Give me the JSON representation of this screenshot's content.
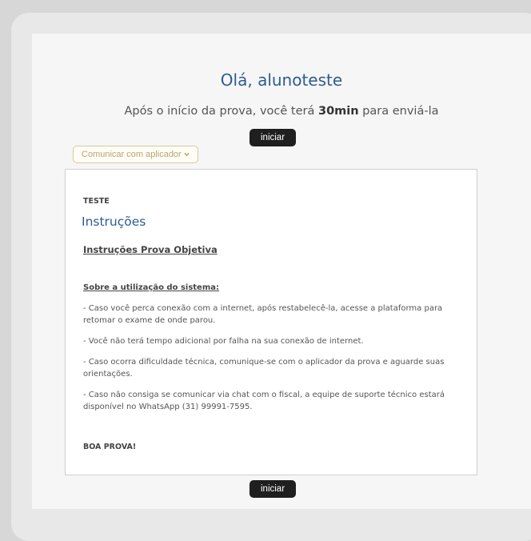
{
  "header": {
    "greeting": "Olá, alunoteste",
    "duration_before": "Após o início da prova, você terá ",
    "duration_value": "30min",
    "duration_after": " para enviá-la"
  },
  "actions": {
    "start_label": "iniciar",
    "contact_label": "Comunicar com aplicador",
    "contact_icon": "chevron-down-icon"
  },
  "content": {
    "label": "TESTE",
    "title": "Instruções",
    "subtitle": "Instruções Prova Objetiva",
    "section": "Sobre a utilização do sistema:",
    "paragraphs": [
      "- Caso você perca conexão com a internet, após restabelecê-la, acesse a plataforma para retomar o exame de onde parou.",
      "- Você não terá tempo adicional por falha na sua conexão de internet.",
      "- Caso ocorra dificuldade técnica, comunique-se com o aplicador da prova e aguarde suas orientações.",
      "- Caso não consiga se comunicar via chat com o fiscal, a equipe de suporte técnico estará disponível no WhatsApp (31) 99991-7595."
    ],
    "closing": "BOA PROVA!"
  },
  "colors": {
    "accent": "#2d5c8f",
    "button": "#1f1f1f",
    "contact_border": "#d8c9a2"
  }
}
